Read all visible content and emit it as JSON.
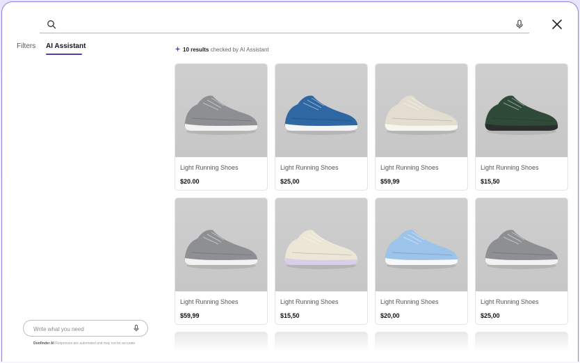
{
  "search": {
    "value": "",
    "placeholder": ""
  },
  "tabs": [
    {
      "label": "Filters",
      "active": false
    },
    {
      "label": "AI Assistant",
      "active": true
    }
  ],
  "results": {
    "count_text": "10 results",
    "suffix": " checked by AI Assistant"
  },
  "products": [
    {
      "name": "Light Running Shoes",
      "price": "$20.00",
      "shoe_color": "#8d8f93",
      "sole_color": "#f2f2f2"
    },
    {
      "name": "Light Running Shoes",
      "price": "$25,00",
      "shoe_color": "#2f67a3",
      "sole_color": "#f5f5f5"
    },
    {
      "name": "Light Running Shoes",
      "price": "$59,99",
      "shoe_color": "#e2ddcf",
      "sole_color": "#f7f5ee"
    },
    {
      "name": "Light Running Shoes",
      "price": "$15,50",
      "shoe_color": "#2f4a37",
      "sole_color": "#2b2e2c"
    },
    {
      "name": "Light Running Shoes",
      "price": "$59,99",
      "shoe_color": "#8d8f93",
      "sole_color": "#f2f2f2"
    },
    {
      "name": "Light Running Shoes",
      "price": "$15,50",
      "shoe_color": "#ece6d6",
      "sole_color": "#d9cfe6"
    },
    {
      "name": "Light Running Shoes",
      "price": "$20,00",
      "shoe_color": "#9cc4ea",
      "sole_color": "#f6f8fb"
    },
    {
      "name": "Light Running Shoes",
      "price": "$25,00",
      "shoe_color": "#8d8f93",
      "sole_color": "#f2f2f2"
    }
  ],
  "assistant": {
    "placeholder": "Write what you need",
    "disclaimer_brand": "Doofinder AI",
    "disclaimer_text": " Responses are automated and may not be accurate"
  },
  "colors": {
    "accent": "#4b3fa6",
    "border": "#8e82d6",
    "search_underline": "#8fc3da"
  }
}
